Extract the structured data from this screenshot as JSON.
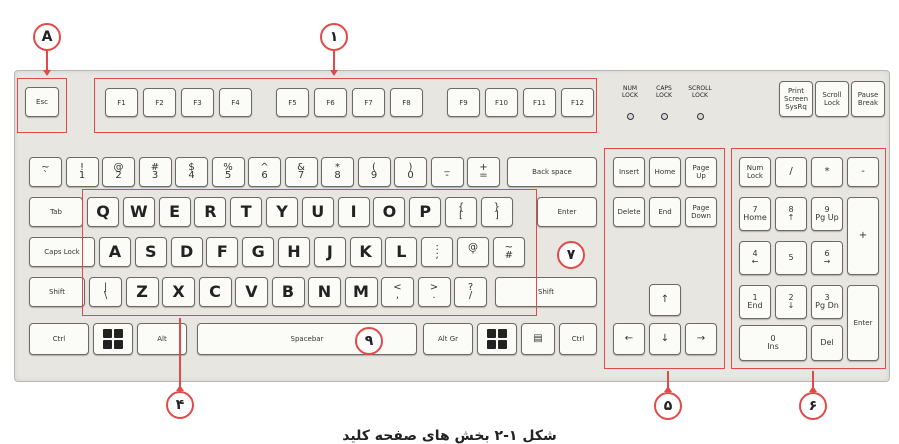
{
  "caption": "شکل ۱-۲ بخش های صفحه کلید",
  "colors": {
    "highlight": "#e24a4a",
    "board": "#e8e6e1",
    "key": "#fbfbf8"
  },
  "markers": {
    "A": "A",
    "1": "١",
    "4": "۴",
    "5": "۵",
    "6": "۶",
    "7": "٧",
    "9": "۹"
  },
  "leds": [
    "NUM\nLOCK",
    "CAPS\nLOCK",
    "SCROLL\nLOCK"
  ],
  "keys": {
    "esc": "Esc",
    "f": [
      "F1",
      "F2",
      "F3",
      "F4",
      "F5",
      "F6",
      "F7",
      "F8",
      "F9",
      "F10",
      "F11",
      "F12"
    ],
    "sys": [
      "Print\nScreen\nSysRq",
      "Scroll\nLock",
      "Pause\nBreak"
    ],
    "num_row": [
      "~\n`",
      "!\n1",
      "@\n2",
      "#\n3",
      "$\n4",
      "%\n5",
      "^\n6",
      "&\n7",
      "*\n8",
      "(\n9",
      ")\n0",
      "_\n-",
      "+\n="
    ],
    "backspace": "Back space",
    "tab": "Tab",
    "row_q": [
      "Q",
      "W",
      "E",
      "R",
      "T",
      "Y",
      "U",
      "I",
      "O",
      "P",
      "{\n[",
      "}\n]"
    ],
    "enter": "Enter",
    "caps": "Caps Lock",
    "row_a": [
      "A",
      "S",
      "D",
      "F",
      "G",
      "H",
      "J",
      "K",
      "L",
      ":\n;",
      "@\n'",
      "~\n#"
    ],
    "shift": "Shift",
    "row_z": [
      "|\n\\",
      "Z",
      "X",
      "C",
      "V",
      "B",
      "N",
      "M",
      "<\n,",
      ">\n.",
      "?\n/"
    ],
    "ctrl": "Ctrl",
    "alt": "Alt",
    "space": "Spacebar",
    "altgr": "Alt Gr",
    "menu": "▤",
    "nav": [
      "Insert",
      "Home",
      "Page\nUp",
      "Delete",
      "End",
      "Page\nDown"
    ],
    "arrows": [
      "↑",
      "←",
      "↓",
      "→"
    ],
    "numpad": {
      "r1": [
        "Num\nLock",
        "/",
        "*",
        "-"
      ],
      "r2": [
        "7\nHome",
        "8\n↑",
        "9\nPg Up"
      ],
      "plus": "+",
      "r3": [
        "4\n←",
        "5",
        "6\n→"
      ],
      "r4": [
        "1\nEnd",
        "2\n↓",
        "3\nPg Dn"
      ],
      "enter": "Enter",
      "r5": [
        "0\nIns",
        "Del"
      ]
    }
  }
}
